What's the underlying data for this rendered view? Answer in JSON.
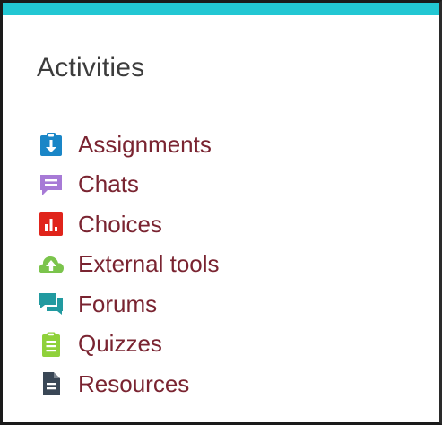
{
  "block": {
    "title": "Activities",
    "accent_color": "#22c7d3",
    "link_color": "#7a2431"
  },
  "activities": [
    {
      "label": "Assignments",
      "icon": "assignment-icon",
      "color": "#1a86c7"
    },
    {
      "label": "Chats",
      "icon": "chat-icon",
      "color": "#a77ad6"
    },
    {
      "label": "Choices",
      "icon": "choice-icon",
      "color": "#e0241b"
    },
    {
      "label": "External tools",
      "icon": "external-tool-icon",
      "color": "#7bc44c"
    },
    {
      "label": "Forums",
      "icon": "forum-icon",
      "color": "#219aa0"
    },
    {
      "label": "Quizzes",
      "icon": "quiz-icon",
      "color": "#8fd13a"
    },
    {
      "label": "Resources",
      "icon": "resource-icon",
      "color": "#3a4756"
    }
  ]
}
